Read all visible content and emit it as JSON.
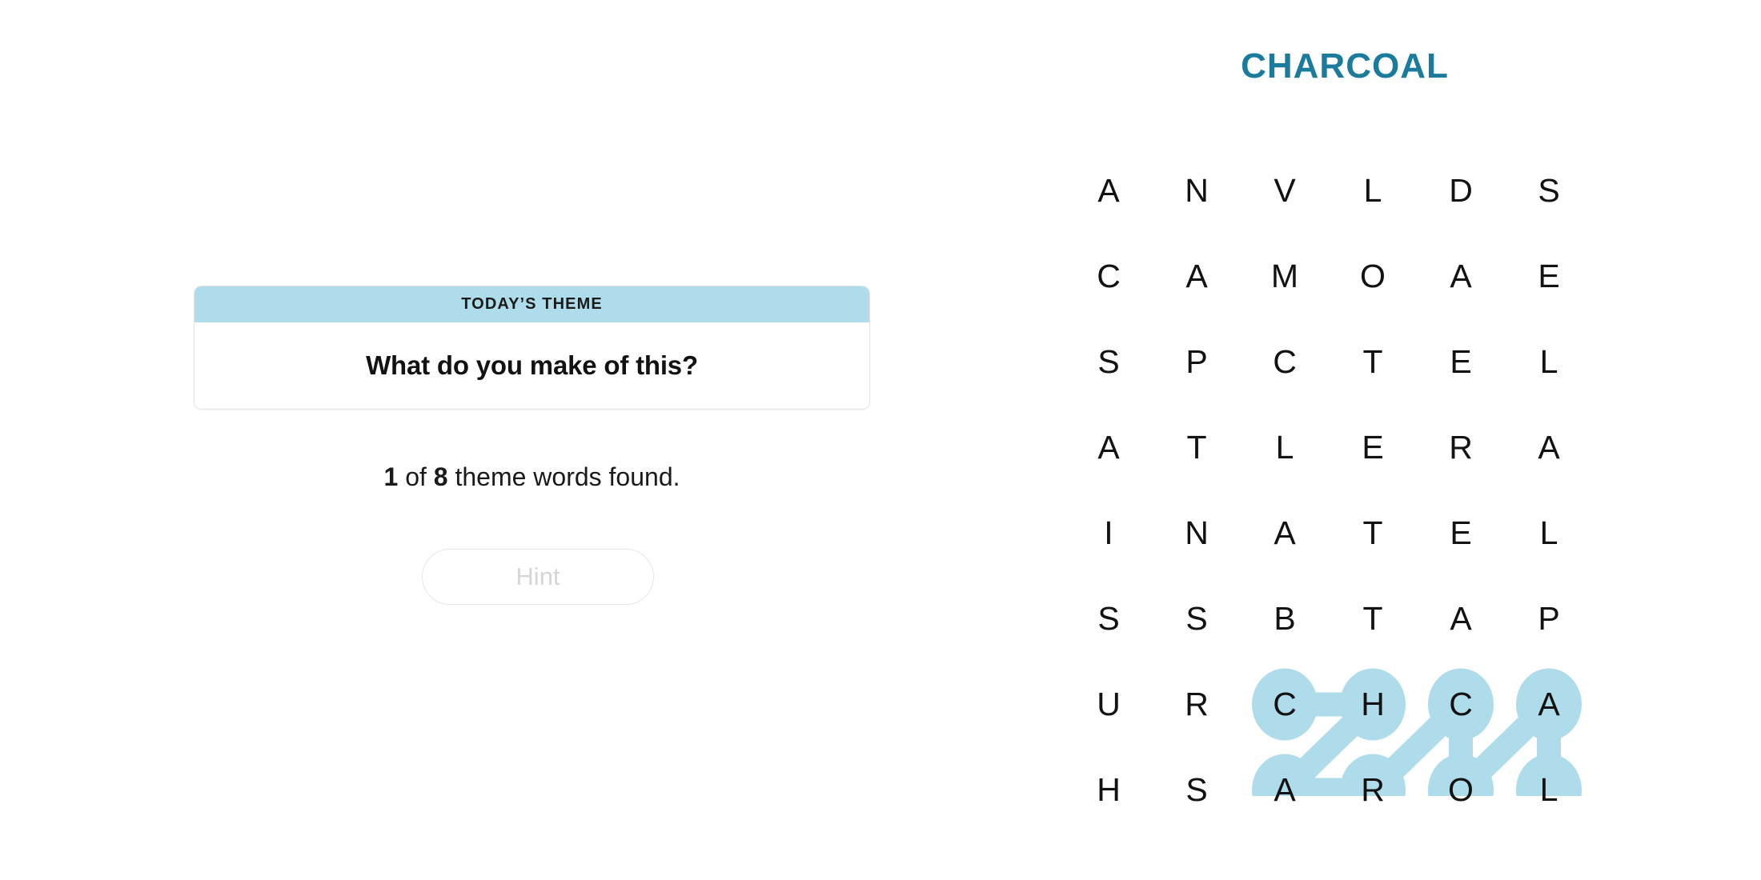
{
  "puzzle": {
    "title": "CHARCOAL",
    "title_color": "#1a7b9d",
    "highlight_color": "#aedceb",
    "columns": 6,
    "rows": 8,
    "grid": [
      [
        "A",
        "N",
        "V",
        "L",
        "D",
        "S"
      ],
      [
        "C",
        "A",
        "M",
        "O",
        "A",
        "E"
      ],
      [
        "S",
        "P",
        "C",
        "T",
        "E",
        "L"
      ],
      [
        "A",
        "T",
        "L",
        "E",
        "R",
        "A"
      ],
      [
        "I",
        "N",
        "A",
        "T",
        "E",
        "L"
      ],
      [
        "S",
        "S",
        "B",
        "T",
        "A",
        "P"
      ],
      [
        "U",
        "R",
        "C",
        "H",
        "C",
        "A"
      ],
      [
        "H",
        "S",
        "A",
        "R",
        "O",
        "L"
      ]
    ],
    "found_word": {
      "word": "CHARCOAL",
      "path": [
        {
          "row": 6,
          "col": 2,
          "letter": "C"
        },
        {
          "row": 6,
          "col": 3,
          "letter": "H"
        },
        {
          "row": 7,
          "col": 2,
          "letter": "A"
        },
        {
          "row": 7,
          "col": 3,
          "letter": "R"
        },
        {
          "row": 6,
          "col": 4,
          "letter": "C"
        },
        {
          "row": 7,
          "col": 4,
          "letter": "O"
        },
        {
          "row": 6,
          "col": 5,
          "letter": "A"
        },
        {
          "row": 7,
          "col": 5,
          "letter": "L"
        }
      ]
    }
  },
  "theme_card": {
    "header_label": "TODAY’S THEME",
    "theme_question": "What do you make of this?",
    "header_bg": "#aedceb"
  },
  "progress": {
    "found_count": "1",
    "connector_word": " of ",
    "total_count": "8",
    "suffix": " theme words found."
  },
  "hint": {
    "label": "Hint",
    "enabled": false
  }
}
